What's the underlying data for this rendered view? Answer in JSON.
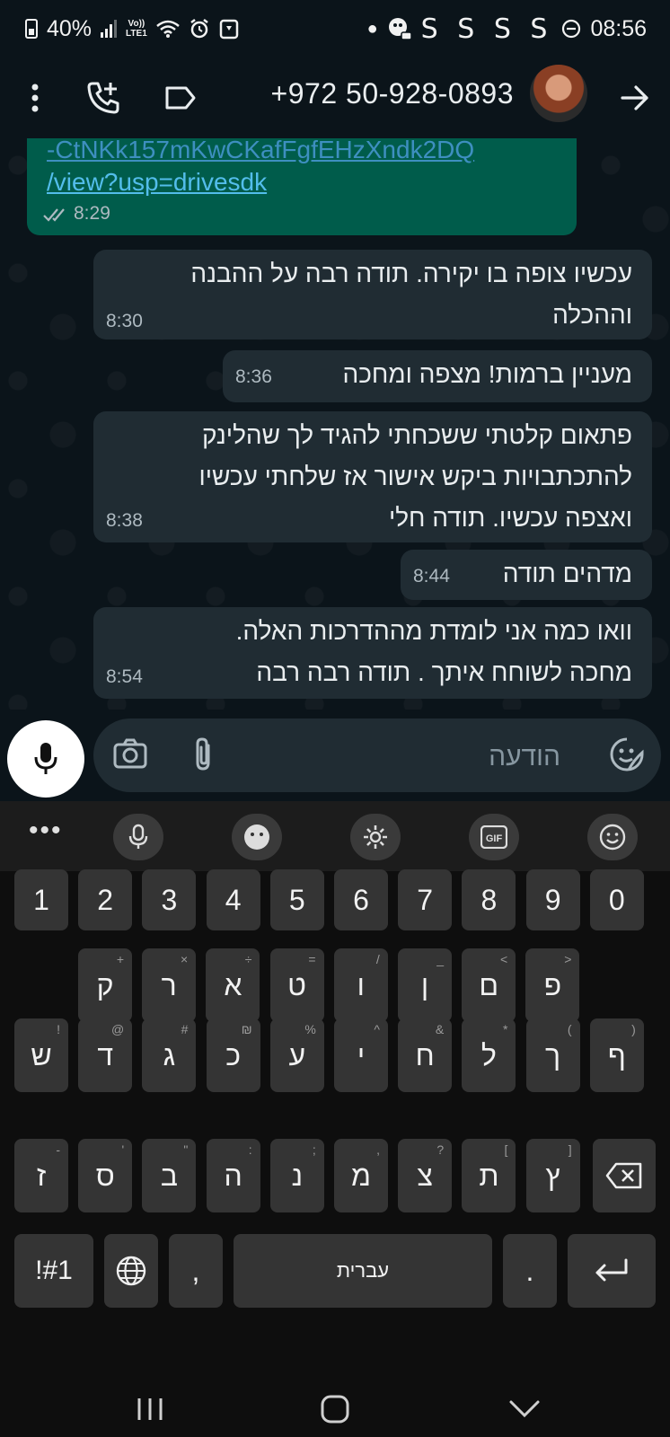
{
  "status_bar": {
    "battery": "40%",
    "network": "Vo)) LTE1",
    "s_icons": "S S S S",
    "time": "08:56"
  },
  "header": {
    "contact": "+972 50-928-0893"
  },
  "messages": [
    {
      "type": "outgoing",
      "text": "-CtNKk157mKwCKafFgfEHzXndk2DQ",
      "link": "/view?usp=drivesdk",
      "time": "8:29"
    },
    {
      "type": "incoming",
      "text": "עכשיו צופה בו יקירה. תודה רבה על ההבנה\nוההכלה",
      "time": "8:30"
    },
    {
      "type": "incoming",
      "text": "מעניין ברמות! מצפה ומחכה",
      "time": "8:36"
    },
    {
      "type": "incoming",
      "text": "פתאום קלטתי ששכחתי להגיד לך שהלינק\nלהתכתבויות ביקש אישור אז שלחתי עכשיו\nואצפה עכשיו. תודה חלי",
      "time": "8:38"
    },
    {
      "type": "incoming",
      "text": "מדהים תודה",
      "time": "8:44"
    },
    {
      "type": "incoming",
      "text": "וואו כמה אני לומדת מההדרכות האלה.\nמחכה לשוחח איתך . תודה רבה רבה",
      "time": "8:54"
    }
  ],
  "composer": {
    "placeholder": "הודעה"
  },
  "keyboard": {
    "numbers": [
      "1",
      "2",
      "3",
      "4",
      "5",
      "6",
      "7",
      "8",
      "9",
      "0"
    ],
    "row1": [
      {
        "k": "ק",
        "h": "+"
      },
      {
        "k": "ר",
        "h": "×"
      },
      {
        "k": "א",
        "h": "÷"
      },
      {
        "k": "ט",
        "h": "="
      },
      {
        "k": "ו",
        "h": "/"
      },
      {
        "k": "ן",
        "h": "_"
      },
      {
        "k": "ם",
        "h": "<"
      },
      {
        "k": "פ",
        "h": ">"
      }
    ],
    "row2": [
      {
        "k": "ש",
        "h": "!"
      },
      {
        "k": "ד",
        "h": "@"
      },
      {
        "k": "ג",
        "h": "#"
      },
      {
        "k": "כ",
        "h": "₪"
      },
      {
        "k": "ע",
        "h": "%"
      },
      {
        "k": "י",
        "h": "^"
      },
      {
        "k": "ח",
        "h": "&"
      },
      {
        "k": "ל",
        "h": "*"
      },
      {
        "k": "ך",
        "h": "("
      },
      {
        "k": "ף",
        "h": ")"
      }
    ],
    "row3": [
      {
        "k": "ז",
        "h": "-"
      },
      {
        "k": "ס",
        "h": "'"
      },
      {
        "k": "ב",
        "h": "\""
      },
      {
        "k": "ה",
        "h": ":"
      },
      {
        "k": "נ",
        "h": ";"
      },
      {
        "k": "מ",
        "h": ","
      },
      {
        "k": "צ",
        "h": "?"
      },
      {
        "k": "ת",
        "h": "["
      },
      {
        "k": "ץ",
        "h": "]"
      }
    ],
    "symbols_key": "!#1",
    "comma": ",",
    "space_label": "עברית",
    "period": "."
  }
}
